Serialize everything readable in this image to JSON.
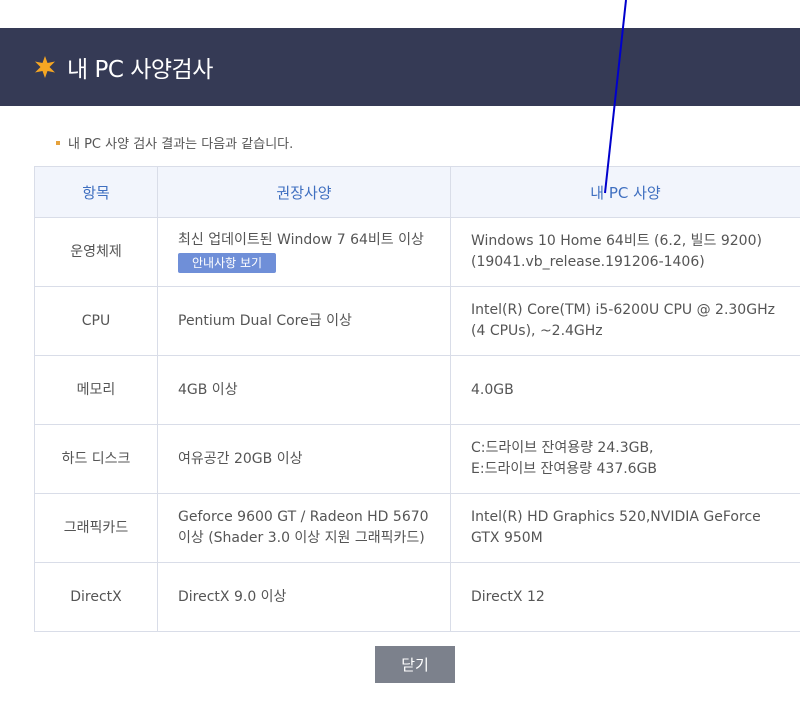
{
  "header": {
    "title": "내 PC 사양검사",
    "icon": "star-burst-icon",
    "background_color": "#353a55",
    "icon_color": "#f5a623"
  },
  "intro": {
    "text": "내 PC 사양 검사 결과는 다음과 같습니다."
  },
  "table": {
    "columns": [
      "항목",
      "권장사양",
      "내 PC 사양"
    ],
    "rows": [
      {
        "item": "운영체제",
        "recommended": "최신 업데이트된 Window 7 64비트 이상",
        "recommended_button": "안내사항 보기",
        "mine": "Windows 10 Home 64비트 (6.2, 빌드 9200) (19041.vb_release.191206-1406)"
      },
      {
        "item": "CPU",
        "recommended": "Pentium Dual Core급 이상",
        "mine": "Intel(R) Core(TM) i5-6200U CPU @ 2.30GHz (4 CPUs), ~2.4GHz"
      },
      {
        "item": "메모리",
        "recommended": "4GB 이상",
        "mine": "4.0GB"
      },
      {
        "item": "하드 디스크",
        "recommended": "여유공간 20GB 이상",
        "mine_lines": [
          "C:드라이브 잔여용량 24.3GB,",
          "E:드라이브 잔여용량 437.6GB"
        ]
      },
      {
        "item": "그래픽카드",
        "recommended": "Geforce 9600 GT / Radeon HD 5670 이상 (Shader 3.0 이상 지원 그래픽카드)",
        "mine": "Intel(R) HD Graphics 520,NVIDIA GeForce GTX 950M"
      },
      {
        "item": "DirectX",
        "recommended": "DirectX 9.0 이상",
        "mine": "DirectX 12"
      }
    ]
  },
  "footer": {
    "close_label": "닫기"
  },
  "colors": {
    "header_text": "#3f6fc0",
    "guide_button": "#6f8fd8",
    "close_button": "#7c818c",
    "annotation_line": "#0000cc"
  }
}
